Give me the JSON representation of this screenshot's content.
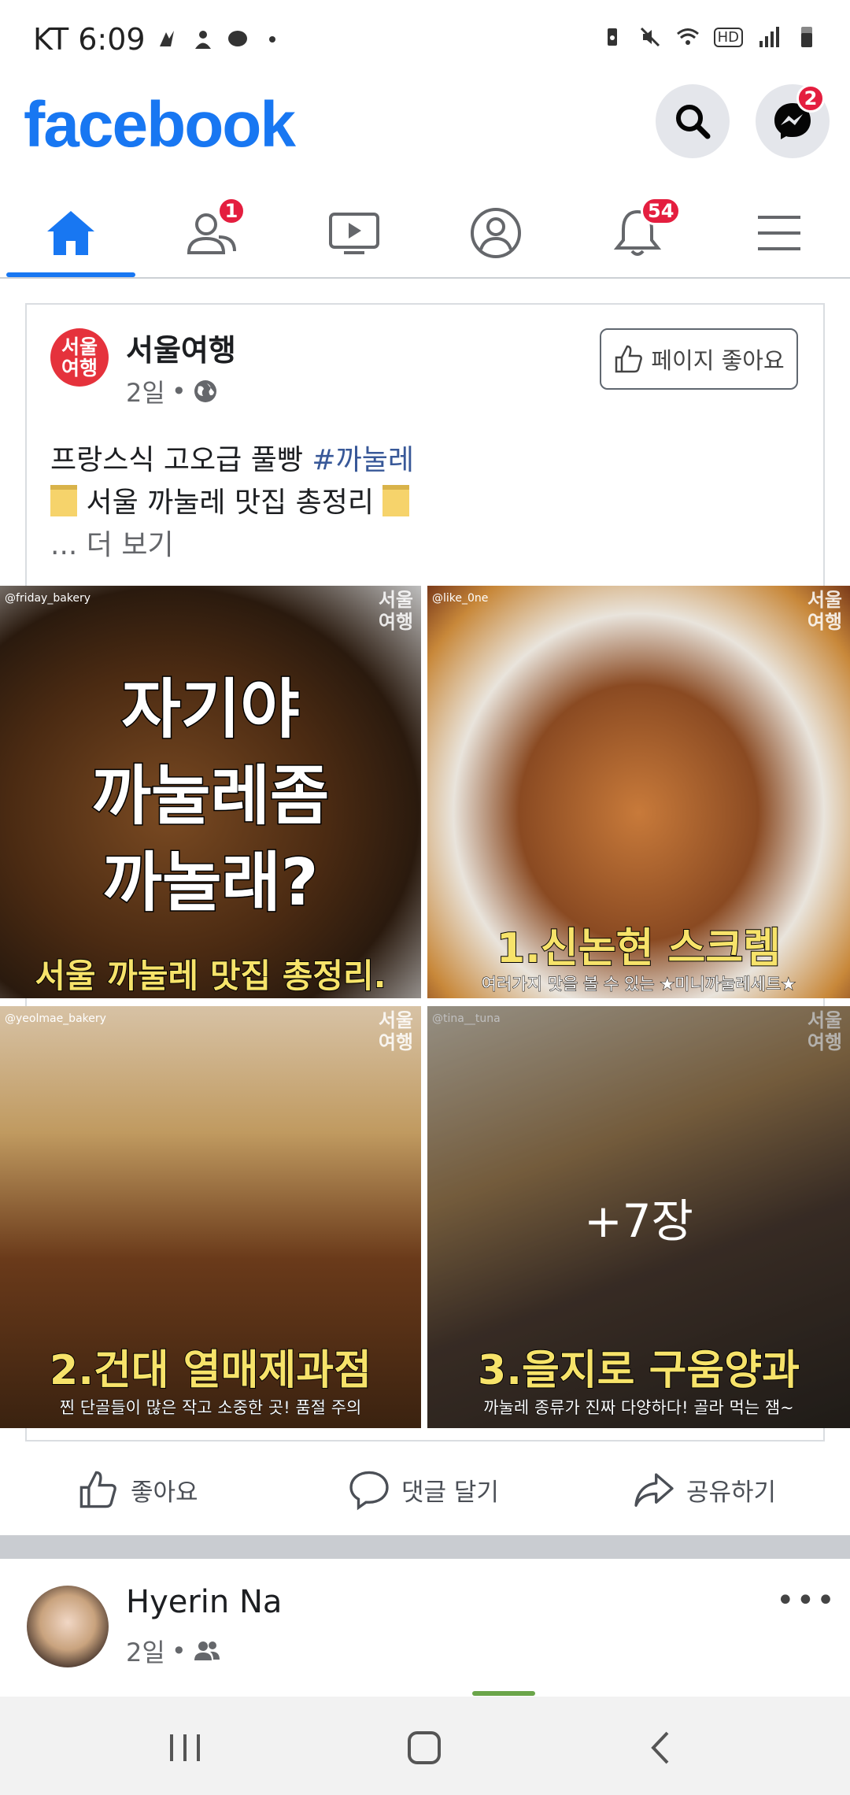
{
  "status_bar": {
    "carrier_time": "KT 6:09",
    "icons_left": [
      "notification-icon",
      "assistant-icon",
      "chat-bubble-icon",
      "dot-icon"
    ],
    "icons_right": [
      "battery-saver-icon",
      "mute-icon",
      "wifi-icon",
      "hd-icon",
      "signal-icon",
      "battery-icon"
    ],
    "hd_label": "HD"
  },
  "header": {
    "logo": "facebook",
    "messenger_badge": "2"
  },
  "nav": {
    "tabs": [
      {
        "name": "home",
        "icon": "home-icon",
        "badge": ""
      },
      {
        "name": "friends",
        "icon": "friends-icon",
        "badge": "1"
      },
      {
        "name": "watch",
        "icon": "video-icon",
        "badge": ""
      },
      {
        "name": "profile",
        "icon": "profile-icon",
        "badge": ""
      },
      {
        "name": "notifications",
        "icon": "bell-icon",
        "badge": "54"
      },
      {
        "name": "menu",
        "icon": "menu-icon",
        "badge": ""
      }
    ],
    "accent": "#1877f2"
  },
  "post1": {
    "avatar_text_line1": "서울",
    "avatar_text_line2": "여행",
    "page_name": "서울여행",
    "time": "2일",
    "like_page_label": "페이지 좋아요",
    "text_line1_plain": "프랑스식 고오급 풀빵 ",
    "text_line1_hashtag": "#까눌레",
    "text_line2": "서울 까눌레 맛집 총정리",
    "see_more": "... 더 보기",
    "photos": [
      {
        "credit": "@friday_bakery",
        "watermark1": "서울",
        "watermark2": "여행",
        "big1": "자기야",
        "big2": "까눌레좀",
        "big3": "까놀래?",
        "caption": "서울 까눌레 맛집 총정리."
      },
      {
        "credit": "@like_0ne",
        "watermark1": "서울",
        "watermark2": "여행",
        "caption": "1.신논현 스크렘",
        "subcaption": "여러가지 맛을 볼 수 있는 ★미니까눌레세트★"
      },
      {
        "credit": "@yeolmae_bakery",
        "watermark1": "서울",
        "watermark2": "여행",
        "caption": "2.건대 열매제과점",
        "subcaption": "찐 단골들이 많은 작고 소중한 곳! 품절 주의"
      },
      {
        "credit": "@tina__tuna",
        "watermark1": "서울",
        "watermark2": "여행",
        "caption": "3.을지로 구움양과",
        "subcaption": "까눌레 종류가 진짜 다양하다! 골라 먹는 잼~",
        "more": "+7장"
      }
    ],
    "actions": {
      "like": "좋아요",
      "comment": "댓글 달기",
      "share": "공유하기"
    }
  },
  "post2": {
    "author": "Hyerin Na",
    "time": "2일",
    "more": "•••"
  }
}
